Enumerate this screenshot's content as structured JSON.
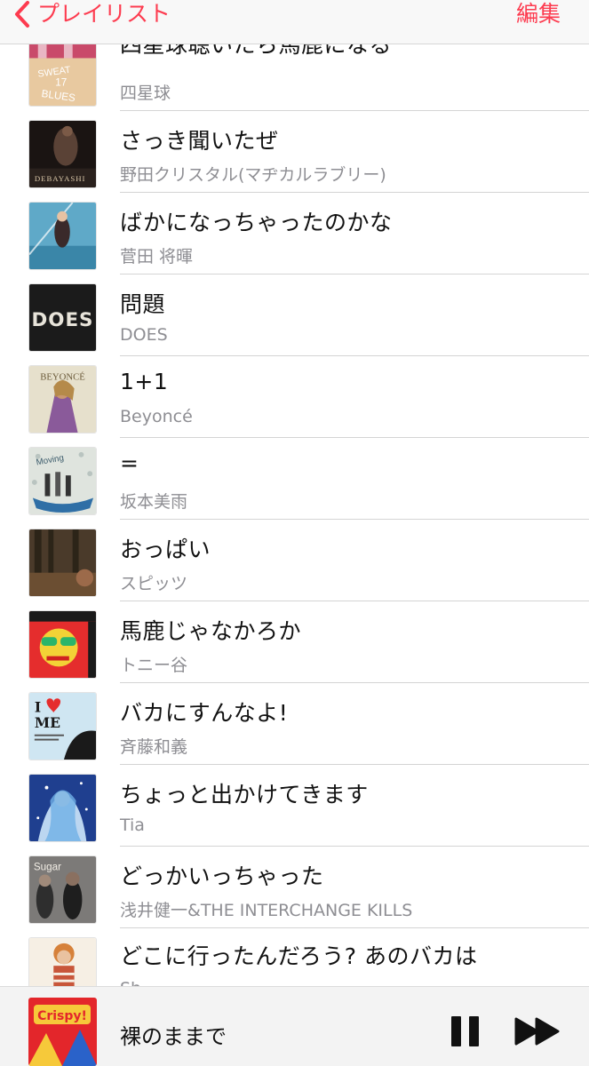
{
  "nav": {
    "back_label": "プレイリスト",
    "edit_label": "編集",
    "accent_color": "#fd3b4f"
  },
  "songs": [
    {
      "title": "四星球聴いたら馬鹿になる",
      "artist": "四星球",
      "art_text": "SWEAT 17 BLUES"
    },
    {
      "title": "さっき聞いたぜ",
      "artist": "野田クリスタル(マヂカルラブリー)",
      "art_text": "DEBAYASHI"
    },
    {
      "title": "ばかになっちゃったのかな",
      "artist": "菅田 将暉",
      "art_text": ""
    },
    {
      "title": "問題",
      "artist": "DOES",
      "art_text": "DOES"
    },
    {
      "title": "1+1",
      "artist": "Beyoncé",
      "art_text": "BEYONCÉ"
    },
    {
      "title": "=",
      "artist": "坂本美雨",
      "art_text": "Moving"
    },
    {
      "title": "おっぱい",
      "artist": "スピッツ",
      "art_text": ""
    },
    {
      "title": "馬鹿じゃなかろか",
      "artist": "トニー谷",
      "art_text": ""
    },
    {
      "title": "バカにすんなよ!",
      "artist": "斉藤和義",
      "art_text": "I ♥ ME"
    },
    {
      "title": "ちょっと出かけてきます",
      "artist": "Tia",
      "art_text": ""
    },
    {
      "title": "どっかいっちゃった",
      "artist": "浅井健一&THE INTERCHANGE KILLS",
      "art_text": "Sugar"
    },
    {
      "title": "どこに行ったんだろう? あのバカは",
      "artist": "Sh...",
      "art_text": ""
    }
  ],
  "now_playing": {
    "title": "裸のままで",
    "art_text": "Crispy!"
  }
}
